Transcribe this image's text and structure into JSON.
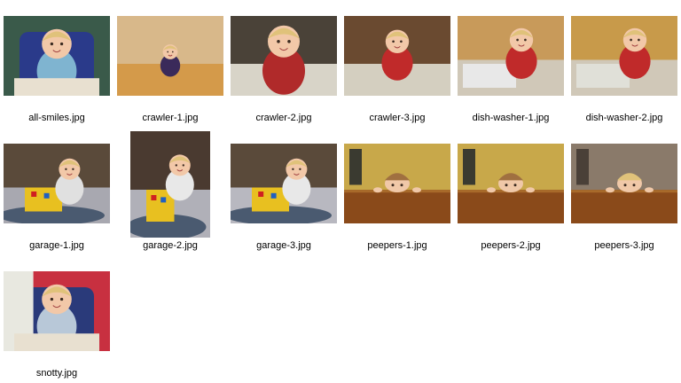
{
  "gallery": {
    "items": [
      {
        "filename": "all-smiles.jpg",
        "scene": "highchair",
        "colors": {
          "bg": "#3a5a4a",
          "floor": "#e8e0d0",
          "shirt": "#7fb4d0",
          "chair": "#2a3a8a"
        }
      },
      {
        "filename": "crawler-1.jpg",
        "scene": "crawl-far",
        "colors": {
          "bg": "#d8b88a",
          "floor": "#d49a4a",
          "shirt": "#3a2a5a",
          "chair": "#b07a3a"
        }
      },
      {
        "filename": "crawler-2.jpg",
        "scene": "crawl-close",
        "colors": {
          "bg": "#4a4238",
          "floor": "#d8d4c8",
          "shirt": "#b02a2a",
          "chair": "#2a2a3a"
        }
      },
      {
        "filename": "crawler-3.jpg",
        "scene": "crawl-mid",
        "colors": {
          "bg": "#6a4a30",
          "floor": "#d4cfc0",
          "shirt": "#c02a2a",
          "chair": "#2a2a2a"
        }
      },
      {
        "filename": "dish-washer-1.jpg",
        "scene": "dishwasher",
        "colors": {
          "bg": "#c89a5a",
          "floor": "#e8e8e8",
          "shirt": "#c02a2a",
          "chair": "#6a6a6a"
        }
      },
      {
        "filename": "dish-washer-2.jpg",
        "scene": "dishwasher-2",
        "colors": {
          "bg": "#c89a4a",
          "floor": "#e0e0d8",
          "shirt": "#c02a2a",
          "chair": "#5a6a4a"
        }
      },
      {
        "filename": "garage-1.jpg",
        "scene": "garage",
        "colors": {
          "bg": "#5a4a3a",
          "floor": "#a8a8b0",
          "shirt": "#e0e0e0",
          "chair": "#e8c020"
        }
      },
      {
        "filename": "garage-2.jpg",
        "scene": "garage-portrait",
        "colors": {
          "bg": "#4a3a30",
          "floor": "#b0b0b8",
          "shirt": "#e8e8e8",
          "chair": "#e8c020"
        }
      },
      {
        "filename": "garage-3.jpg",
        "scene": "garage-3",
        "colors": {
          "bg": "#5a4a3a",
          "floor": "#b8b8c0",
          "shirt": "#e8e8e8",
          "chair": "#e8c020"
        }
      },
      {
        "filename": "peepers-1.jpg",
        "scene": "peepers",
        "colors": {
          "bg": "#c8a84a",
          "floor": "#8a4a1a",
          "shirt": "#c8b098",
          "chair": "#3a3a30"
        }
      },
      {
        "filename": "peepers-2.jpg",
        "scene": "peepers",
        "colors": {
          "bg": "#c8a84a",
          "floor": "#8a4a1a",
          "shirt": "#c8b098",
          "chair": "#3a3a30"
        }
      },
      {
        "filename": "peepers-3.jpg",
        "scene": "peepers-3",
        "colors": {
          "bg": "#8a7a6a",
          "floor": "#8a4a1a",
          "shirt": "#e8d8c0",
          "chair": "#4a4038"
        }
      },
      {
        "filename": "snotty.jpg",
        "scene": "snotty",
        "colors": {
          "bg": "#c83040",
          "floor": "#e8e0d0",
          "shirt": "#b8c8d8",
          "chair": "#2a3a7a"
        }
      }
    ]
  }
}
